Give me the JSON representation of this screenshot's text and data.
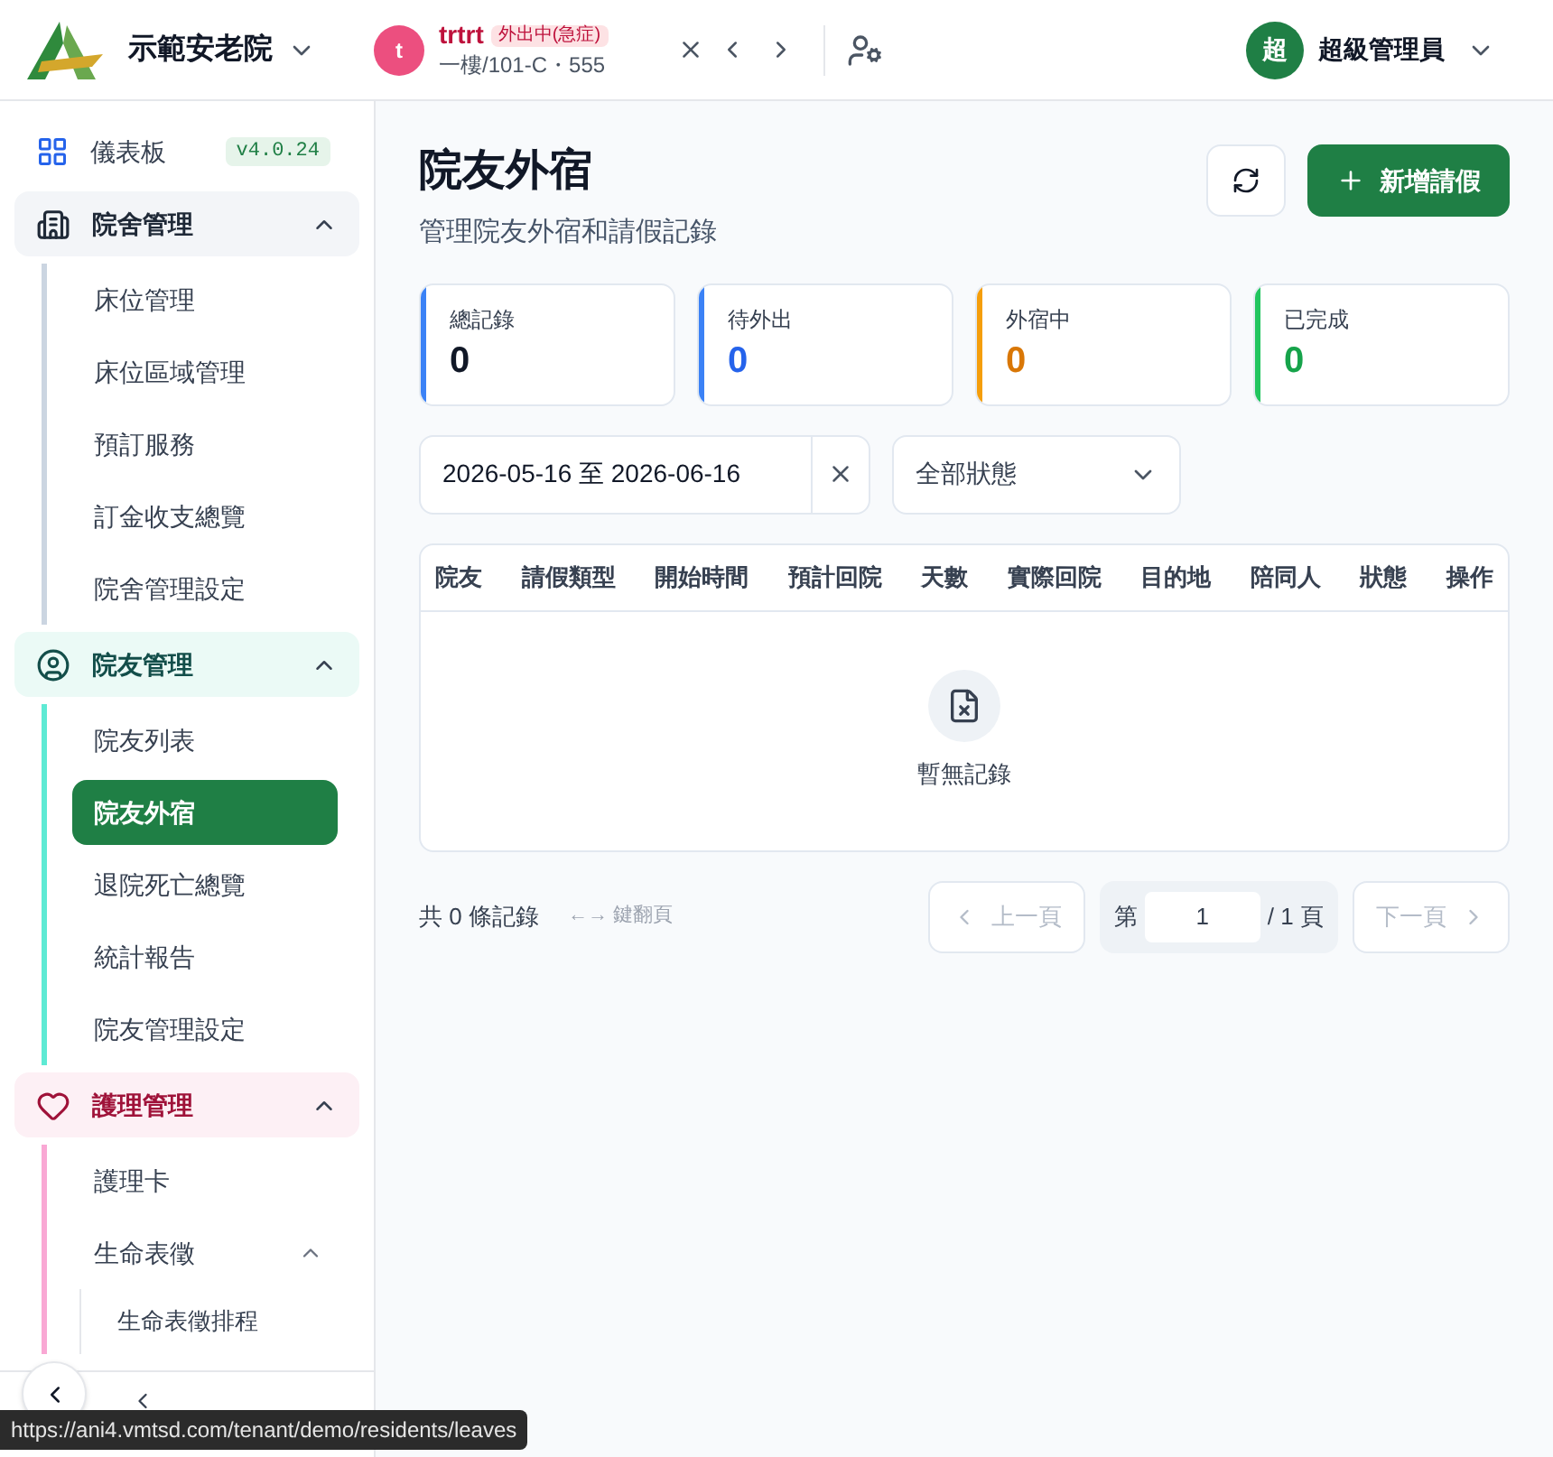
{
  "header": {
    "org_name": "示範安老院",
    "resident": {
      "avatar": "t",
      "name": "trtrt",
      "status_badge": "外出中(急症)",
      "location": "一樓/101-C・555"
    },
    "user": {
      "avatar": "超",
      "name": "超級管理員"
    }
  },
  "sidebar": {
    "items": [
      {
        "kind": "link",
        "label": "儀表板",
        "version": "v4.0.24"
      },
      {
        "kind": "group",
        "label": "院舍管理",
        "color": "#cbd5e1",
        "expanded": true,
        "children": [
          {
            "label": "床位管理",
            "selected": false
          },
          {
            "label": "床位區域管理",
            "selected": false
          },
          {
            "label": "預訂服務",
            "selected": false
          },
          {
            "label": "訂金收支總覽",
            "selected": false
          },
          {
            "label": "院舍管理設定",
            "selected": false
          }
        ]
      },
      {
        "kind": "group",
        "label": "院友管理",
        "color": "#5eead4",
        "expanded": true,
        "children": [
          {
            "label": "院友列表",
            "selected": false
          },
          {
            "label": "院友外宿",
            "selected": true
          },
          {
            "label": "退院死亡總覽",
            "selected": false
          },
          {
            "label": "統計報告",
            "selected": false
          },
          {
            "label": "院友管理設定",
            "selected": false
          }
        ]
      },
      {
        "kind": "group",
        "label": "護理管理",
        "color": "#f9a8d4",
        "expanded": true,
        "children": [
          {
            "label": "護理卡",
            "selected": false
          },
          {
            "label": "生命表徵",
            "selected": false,
            "expanded": true,
            "children": [
              {
                "label": "生命表徵排程",
                "selected": false
              }
            ]
          }
        ]
      }
    ]
  },
  "page": {
    "title": "院友外宿",
    "subtitle": "管理院友外宿和請假記錄",
    "add_button": "新增請假"
  },
  "stats": [
    {
      "label": "總記錄",
      "value": "0",
      "color": "#3b82f6"
    },
    {
      "label": "待外出",
      "value": "0",
      "color": "#3b82f6"
    },
    {
      "label": "外宿中",
      "value": "0",
      "color": "#f59e0b"
    },
    {
      "label": "已完成",
      "value": "0",
      "color": "#22c55e"
    }
  ],
  "filters": {
    "date_range": "2026-05-16 至 2026-06-16",
    "status": "全部狀態"
  },
  "table": {
    "columns": [
      "院友",
      "請假類型",
      "開始時間",
      "預計回院",
      "天數",
      "實際回院",
      "目的地",
      "陪同人",
      "狀態",
      "操作"
    ],
    "empty_text": "暫無記錄"
  },
  "pagination": {
    "total": "共 0 條記錄",
    "hint": "←→ 鍵翻頁",
    "prev": "上一頁",
    "prev_disabled": true,
    "page_prefix": "第",
    "page": "1",
    "page_suffix": "/ 1 頁",
    "next": "下一頁",
    "next_disabled": true
  },
  "status_url": "https://ani4.vmtsd.com/tenant/demo/residents/leaves"
}
